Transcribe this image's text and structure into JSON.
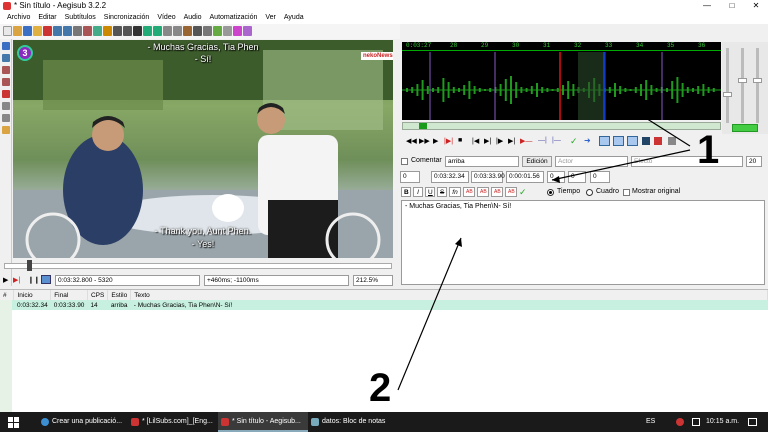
{
  "window": {
    "title": "* Sin título - Aegisub 3.2.2"
  },
  "menu": [
    "Archivo",
    "Editar",
    "Subtítulos",
    "Sincronización",
    "Vídeo",
    "Audio",
    "Automatización",
    "Ver",
    "Ayuda"
  ],
  "video": {
    "channel_logo": "3",
    "watermark": "nekoNews",
    "sub_top_1": "- Muchas Gracias, Tia Phen",
    "sub_top_2": "- Sí!",
    "sub_bottom_1": "- Thank you, Aunt Phen.",
    "sub_bottom_2": "- Yes!",
    "time": "0:03:32.800 - 5320",
    "offset": "+460ms; -1100ms",
    "zoom": "212.5%",
    "seek_position": 0.06
  },
  "audio": {
    "ticks": [
      "0:03:27",
      "28",
      "29",
      "30",
      "31",
      "32",
      "33",
      "34",
      "35",
      "36",
      "37"
    ],
    "colors": {
      "background": "#000000",
      "waveform": "#1f9a1f",
      "selection_start": "#e01010",
      "selection_end": "#1040ff",
      "ruler": "#33cc33"
    }
  },
  "editor": {
    "comment_label": "Comentar",
    "style_value": "arriba",
    "edit_button": "Edición",
    "actor_placeholder": "Actor",
    "effect_placeholder": "Efecto",
    "margin_value": "20",
    "layer": "0",
    "start_time": "0:03:32.34",
    "end_time": "0:03:33.90",
    "duration": "0:00:01.56",
    "margin_l": "0",
    "margin_r": "0",
    "margin_v": "0",
    "format_buttons": [
      "B",
      "I",
      "U",
      "S",
      "fn",
      "AB",
      "AB",
      "AB",
      "AB"
    ],
    "radio_time": "Tiempo",
    "radio_frame": "Cuadro",
    "show_original": "Mostrar original",
    "text": "- Muchas Gracias, Tia Phen\\N- Sí!"
  },
  "grid": {
    "headers": [
      "#",
      "Inicio",
      "Final",
      "CPS",
      "Estilo",
      "Texto"
    ],
    "rows": [
      {
        "num": "1",
        "start": "0:03:32.34",
        "end": "0:03:33.90",
        "cps": "14",
        "style": "arriba",
        "text": "- Muchas Gracias, Tia Phen\\N- Sí!"
      }
    ]
  },
  "annotations": {
    "label_1": "1",
    "label_2": "2"
  },
  "taskbar": {
    "items": [
      "Crear una publicació...",
      "* [LilSubs.com]_[Eng...",
      "* Sin título - Aegisub...",
      "datos: Bloc de notas"
    ],
    "language": "ES",
    "clock": "10:15 a.m."
  }
}
